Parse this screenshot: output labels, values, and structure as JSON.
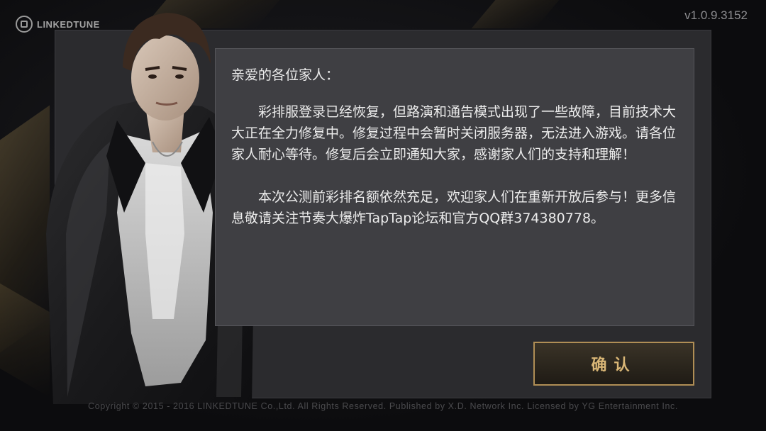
{
  "app": {
    "logo_text": "LINKEDTUNE",
    "version": "v1.0.9.3152"
  },
  "notice": {
    "greeting": "亲爱的各位家人：",
    "paragraph_1": "彩排服登录已经恢复，但路演和通告模式出现了一些故障，目前技术大大正在全力修复中。修复过程中会暂时关闭服务器，无法进入游戏。请各位家人耐心等待。修复后会立即通知大家，感谢家人们的支持和理解！",
    "paragraph_2": "本次公测前彩排名额依然充足，欢迎家人们在重新开放后参与！更多信息敬请关注节奏大爆炸TapTap论坛和官方QQ群374380778。"
  },
  "buttons": {
    "confirm_label": "确认"
  },
  "footer": {
    "copyright": "Copyright © 2015 - 2016 LINKEDTUNE Co.,Ltd. All Rights Reserved. Published by X.D. Network Inc. Licensed by YG Entertainment Inc."
  },
  "colors": {
    "accent_gold": "#b08e55",
    "panel_bg": "#2b2b2e",
    "notice_bg": "#3f3f43"
  }
}
